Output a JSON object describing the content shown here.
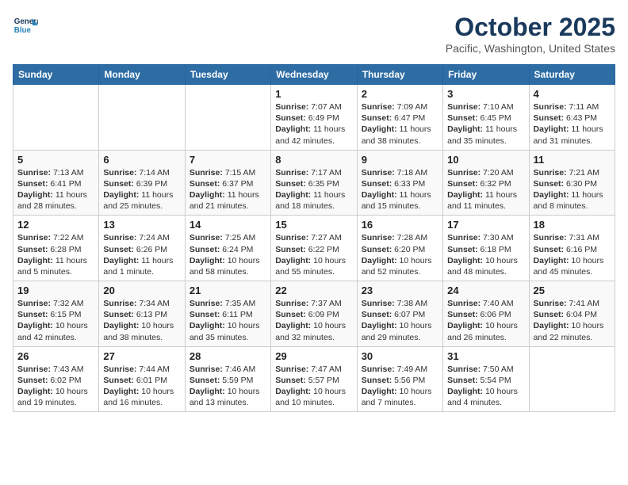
{
  "header": {
    "logo_line1": "General",
    "logo_line2": "Blue",
    "month": "October 2025",
    "location": "Pacific, Washington, United States"
  },
  "weekdays": [
    "Sunday",
    "Monday",
    "Tuesday",
    "Wednesday",
    "Thursday",
    "Friday",
    "Saturday"
  ],
  "weeks": [
    [
      {
        "day": "",
        "content": ""
      },
      {
        "day": "",
        "content": ""
      },
      {
        "day": "",
        "content": ""
      },
      {
        "day": "1",
        "content": "Sunrise: 7:07 AM\nSunset: 6:49 PM\nDaylight: 11 hours and 42 minutes."
      },
      {
        "day": "2",
        "content": "Sunrise: 7:09 AM\nSunset: 6:47 PM\nDaylight: 11 hours and 38 minutes."
      },
      {
        "day": "3",
        "content": "Sunrise: 7:10 AM\nSunset: 6:45 PM\nDaylight: 11 hours and 35 minutes."
      },
      {
        "day": "4",
        "content": "Sunrise: 7:11 AM\nSunset: 6:43 PM\nDaylight: 11 hours and 31 minutes."
      }
    ],
    [
      {
        "day": "5",
        "content": "Sunrise: 7:13 AM\nSunset: 6:41 PM\nDaylight: 11 hours and 28 minutes."
      },
      {
        "day": "6",
        "content": "Sunrise: 7:14 AM\nSunset: 6:39 PM\nDaylight: 11 hours and 25 minutes."
      },
      {
        "day": "7",
        "content": "Sunrise: 7:15 AM\nSunset: 6:37 PM\nDaylight: 11 hours and 21 minutes."
      },
      {
        "day": "8",
        "content": "Sunrise: 7:17 AM\nSunset: 6:35 PM\nDaylight: 11 hours and 18 minutes."
      },
      {
        "day": "9",
        "content": "Sunrise: 7:18 AM\nSunset: 6:33 PM\nDaylight: 11 hours and 15 minutes."
      },
      {
        "day": "10",
        "content": "Sunrise: 7:20 AM\nSunset: 6:32 PM\nDaylight: 11 hours and 11 minutes."
      },
      {
        "day": "11",
        "content": "Sunrise: 7:21 AM\nSunset: 6:30 PM\nDaylight: 11 hours and 8 minutes."
      }
    ],
    [
      {
        "day": "12",
        "content": "Sunrise: 7:22 AM\nSunset: 6:28 PM\nDaylight: 11 hours and 5 minutes."
      },
      {
        "day": "13",
        "content": "Sunrise: 7:24 AM\nSunset: 6:26 PM\nDaylight: 11 hours and 1 minute."
      },
      {
        "day": "14",
        "content": "Sunrise: 7:25 AM\nSunset: 6:24 PM\nDaylight: 10 hours and 58 minutes."
      },
      {
        "day": "15",
        "content": "Sunrise: 7:27 AM\nSunset: 6:22 PM\nDaylight: 10 hours and 55 minutes."
      },
      {
        "day": "16",
        "content": "Sunrise: 7:28 AM\nSunset: 6:20 PM\nDaylight: 10 hours and 52 minutes."
      },
      {
        "day": "17",
        "content": "Sunrise: 7:30 AM\nSunset: 6:18 PM\nDaylight: 10 hours and 48 minutes."
      },
      {
        "day": "18",
        "content": "Sunrise: 7:31 AM\nSunset: 6:16 PM\nDaylight: 10 hours and 45 minutes."
      }
    ],
    [
      {
        "day": "19",
        "content": "Sunrise: 7:32 AM\nSunset: 6:15 PM\nDaylight: 10 hours and 42 minutes."
      },
      {
        "day": "20",
        "content": "Sunrise: 7:34 AM\nSunset: 6:13 PM\nDaylight: 10 hours and 38 minutes."
      },
      {
        "day": "21",
        "content": "Sunrise: 7:35 AM\nSunset: 6:11 PM\nDaylight: 10 hours and 35 minutes."
      },
      {
        "day": "22",
        "content": "Sunrise: 7:37 AM\nSunset: 6:09 PM\nDaylight: 10 hours and 32 minutes."
      },
      {
        "day": "23",
        "content": "Sunrise: 7:38 AM\nSunset: 6:07 PM\nDaylight: 10 hours and 29 minutes."
      },
      {
        "day": "24",
        "content": "Sunrise: 7:40 AM\nSunset: 6:06 PM\nDaylight: 10 hours and 26 minutes."
      },
      {
        "day": "25",
        "content": "Sunrise: 7:41 AM\nSunset: 6:04 PM\nDaylight: 10 hours and 22 minutes."
      }
    ],
    [
      {
        "day": "26",
        "content": "Sunrise: 7:43 AM\nSunset: 6:02 PM\nDaylight: 10 hours and 19 minutes."
      },
      {
        "day": "27",
        "content": "Sunrise: 7:44 AM\nSunset: 6:01 PM\nDaylight: 10 hours and 16 minutes."
      },
      {
        "day": "28",
        "content": "Sunrise: 7:46 AM\nSunset: 5:59 PM\nDaylight: 10 hours and 13 minutes."
      },
      {
        "day": "29",
        "content": "Sunrise: 7:47 AM\nSunset: 5:57 PM\nDaylight: 10 hours and 10 minutes."
      },
      {
        "day": "30",
        "content": "Sunrise: 7:49 AM\nSunset: 5:56 PM\nDaylight: 10 hours and 7 minutes."
      },
      {
        "day": "31",
        "content": "Sunrise: 7:50 AM\nSunset: 5:54 PM\nDaylight: 10 hours and 4 minutes."
      },
      {
        "day": "",
        "content": ""
      }
    ]
  ]
}
